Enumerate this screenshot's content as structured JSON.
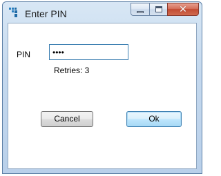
{
  "window": {
    "title": "Enter PIN",
    "icon": "app-icon",
    "caption_buttons": {
      "minimize_icon": "minimize-icon",
      "maximize_icon": "maximize-icon",
      "close_icon": "close-icon",
      "close_glyph": "✕"
    }
  },
  "form": {
    "pin_label": "PIN",
    "pin_value": "••••",
    "retries_text": "Retries: 3"
  },
  "buttons": {
    "cancel_label": "Cancel",
    "ok_label": "Ok"
  },
  "colors": {
    "accent": "#3c7fb1",
    "close_button": "#c24a32"
  }
}
